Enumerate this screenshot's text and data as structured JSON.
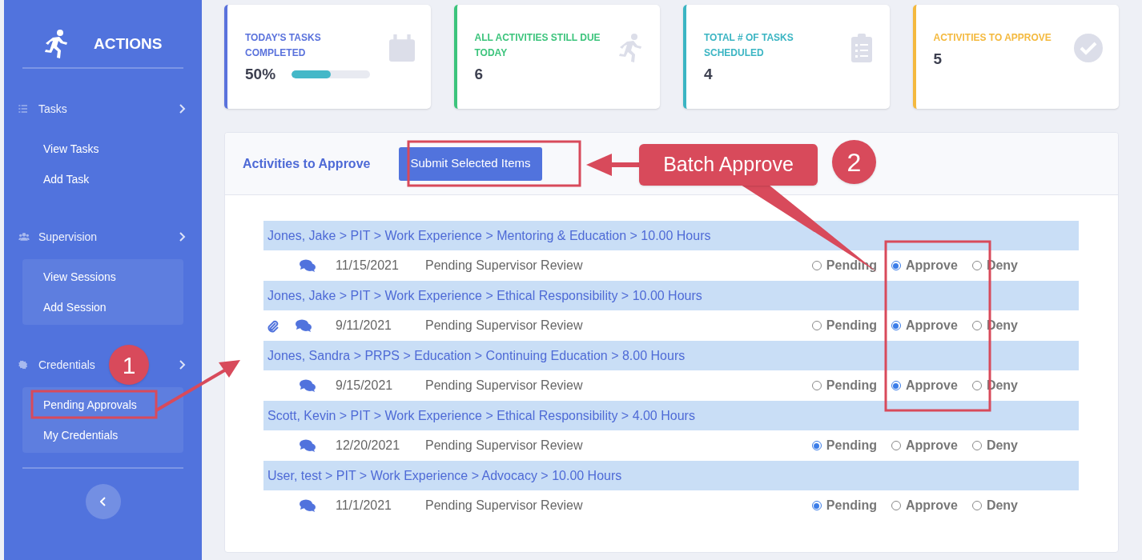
{
  "sidebar": {
    "title": "ACTIONS",
    "groups": [
      {
        "label": "Tasks",
        "items": [
          {
            "label": "View Tasks"
          },
          {
            "label": "Add Task"
          }
        ]
      },
      {
        "label": "Supervision",
        "items": [
          {
            "label": "View Sessions"
          },
          {
            "label": "Add Session"
          }
        ]
      },
      {
        "label": "Credentials",
        "items": [
          {
            "label": "Pending Approvals"
          },
          {
            "label": "My Credentials"
          }
        ]
      }
    ]
  },
  "cards": [
    {
      "label": "TODAY'S TASKS COMPLETED",
      "value": "50%",
      "color": "#5a72dc",
      "level": 0.5
    },
    {
      "label": "ALL ACTIVITIES STILL DUE TODAY",
      "value": "6",
      "color": "#3cc47c"
    },
    {
      "label": "TOTAL # OF TASKS SCHEDULED",
      "value": "4",
      "color": "#3bb5c3"
    },
    {
      "label": "ACTIVITIES TO APPROVE",
      "value": "5",
      "color": "#f4b93e"
    }
  ],
  "panel": {
    "title": "Activities to Approve",
    "submit_button": "Submit Selected Items",
    "rows": [
      {
        "path": "Jones, Jake > PIT > Work Experience > Mentoring & Education > 10.00 Hours",
        "attachment": false,
        "date": "11/15/2021",
        "status": "Pending Supervisor Review",
        "options": [
          {
            "label": "Pending",
            "selected": false
          },
          {
            "label": "Approve",
            "selected": true
          },
          {
            "label": "Deny",
            "selected": false
          }
        ]
      },
      {
        "path": "Jones, Jake > PIT > Work Experience > Ethical Responsibility > 10.00 Hours",
        "attachment": true,
        "date": "9/11/2021",
        "status": "Pending Supervisor Review",
        "options": [
          {
            "label": "Pending",
            "selected": false
          },
          {
            "label": "Approve",
            "selected": true
          },
          {
            "label": "Deny",
            "selected": false
          }
        ]
      },
      {
        "path": "Jones, Sandra > PRPS > Education > Continuing Education > 8.00 Hours",
        "attachment": false,
        "date": "9/15/2021",
        "status": "Pending Supervisor Review",
        "options": [
          {
            "label": "Pending",
            "selected": false
          },
          {
            "label": "Approve",
            "selected": true
          },
          {
            "label": "Deny",
            "selected": false
          }
        ]
      },
      {
        "path": "Scott, Kevin > PIT > Work Experience > Ethical Responsibility > 4.00 Hours",
        "attachment": false,
        "date": "12/20/2021",
        "status": "Pending Supervisor Review",
        "options": [
          {
            "label": "Pending",
            "selected": true
          },
          {
            "label": "Approve",
            "selected": false
          },
          {
            "label": "Deny",
            "selected": false
          }
        ]
      },
      {
        "path": "User, test > PIT > Work Experience > Advocacy > 10.00 Hours",
        "attachment": false,
        "date": "11/1/2021",
        "status": "Pending Supervisor Review",
        "options": [
          {
            "label": "Pending",
            "selected": true
          },
          {
            "label": "Approve",
            "selected": false
          },
          {
            "label": "Deny",
            "selected": false
          }
        ]
      }
    ]
  },
  "annotations": {
    "step_1": "1",
    "step_2": "2",
    "callout": "Batch Approve"
  }
}
